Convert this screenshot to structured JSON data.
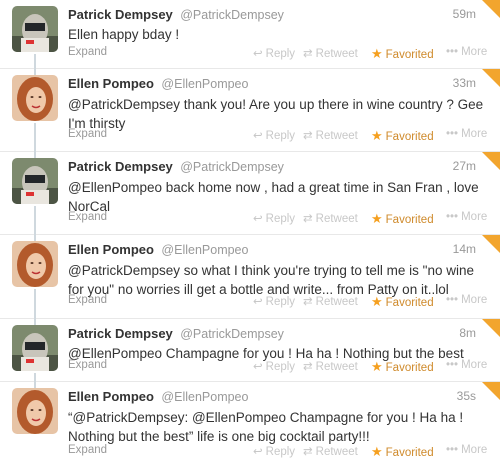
{
  "tweets": [
    {
      "name": "Patrick Dempsey",
      "handle": "@PatrickDempsey",
      "time": "59m",
      "text": "Ellen happy bday !",
      "expand": "Expand",
      "reply": "Reply",
      "retweet": "Retweet",
      "favorited": "Favorited",
      "more": "More",
      "avatar": "patrick"
    },
    {
      "name": "Ellen Pompeo",
      "handle": "@EllenPompeo",
      "time": "33m",
      "text": "@PatrickDempsey thank you! Are you up there in wine country ? Gee I'm thirsty",
      "expand": "Expand",
      "reply": "Reply",
      "retweet": "Retweet",
      "favorited": "Favorited",
      "more": "More",
      "avatar": "ellen"
    },
    {
      "name": "Patrick Dempsey",
      "handle": "@PatrickDempsey",
      "time": "27m",
      "text": "@EllenPompeo back home now , had a great time in  San Fran , love NorCal",
      "expand": "Expand",
      "reply": "Reply",
      "retweet": "Retweet",
      "favorited": "Favorited",
      "more": "More",
      "avatar": "patrick"
    },
    {
      "name": "Ellen Pompeo",
      "handle": "@EllenPompeo",
      "time": "14m",
      "text": "@PatrickDempsey so what I think you're trying to tell me is \"no wine for you\" no worries ill get a bottle and write... from Patty on it..lol",
      "expand": "Expand",
      "reply": "Reply",
      "retweet": "Retweet",
      "favorited": "Favorited",
      "more": "More",
      "avatar": "ellen"
    },
    {
      "name": "Patrick Dempsey",
      "handle": "@PatrickDempsey",
      "time": "8m",
      "text": "@EllenPompeo Champagne for you ! Ha ha ! Nothing but the best",
      "expand": "Expand",
      "reply": "Reply",
      "retweet": "Retweet",
      "favorited": "Favorited",
      "more": "More",
      "avatar": "patrick"
    },
    {
      "name": "Ellen Pompeo",
      "handle": "@EllenPompeo",
      "time": "35s",
      "text": "“@PatrickDempsey: @EllenPompeo Champagne for you ! Ha ha ! Nothing but the best” life is one big cocktail party!!!",
      "expand": "Expand",
      "reply": "Reply",
      "retweet": "Retweet",
      "favorited": "Favorited",
      "more": "More",
      "avatar": "ellen"
    }
  ],
  "icons": {
    "reply": "reply-arrow-icon",
    "retweet": "retweet-icon",
    "favorite": "star-icon",
    "more": "more-dots-icon",
    "corner": "favorited-corner-icon"
  },
  "colors": {
    "favorite_accent": "#f5a020",
    "link_gray": "#999999",
    "connector": "#cfd8de"
  }
}
